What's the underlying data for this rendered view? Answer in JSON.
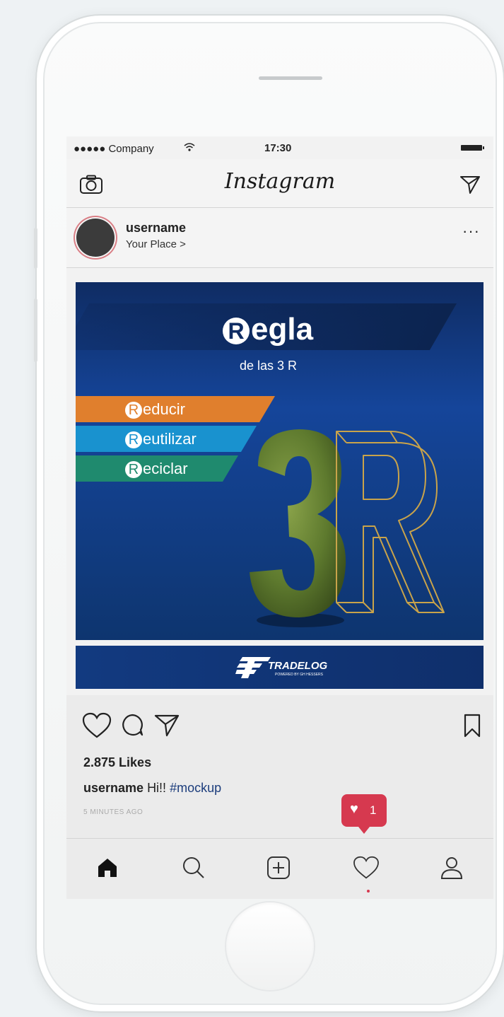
{
  "status_bar": {
    "carrier": "●●●●● Company",
    "time": "17:30"
  },
  "nav": {
    "brand": "Instagram",
    "left_icon": "camera-icon",
    "right_icon": "send-icon"
  },
  "post_header": {
    "username": "username",
    "place": "Your Place >",
    "more": "···"
  },
  "post_image": {
    "title_r": "R",
    "title_rest": "egla",
    "subtitle": "de las 3 R",
    "bars": [
      {
        "r": "R",
        "text": "educir",
        "color": "#e07f2d"
      },
      {
        "r": "R",
        "text": "eutilizar",
        "color": "#1992cf"
      },
      {
        "r": "R",
        "text": "eciclar",
        "color": "#1f8a6e"
      }
    ],
    "graphic_colors": {
      "three": "#5e7a2e",
      "r_outline": "#c9a34a"
    },
    "brand": "TRADELOG",
    "brand_sub": "POWERED BY GH HESSERS"
  },
  "post_actions": {
    "likes": "2.875 Likes",
    "caption_user": "username",
    "caption_text": "Hi!!",
    "caption_tag": "#mockup",
    "time_ago": "5 MINUTES AGO"
  },
  "notification": {
    "count": "1",
    "color": "#d6394f"
  },
  "tabbar": {
    "icons": [
      "home-icon",
      "search-icon",
      "add-icon",
      "activity-icon",
      "profile-icon"
    ]
  }
}
